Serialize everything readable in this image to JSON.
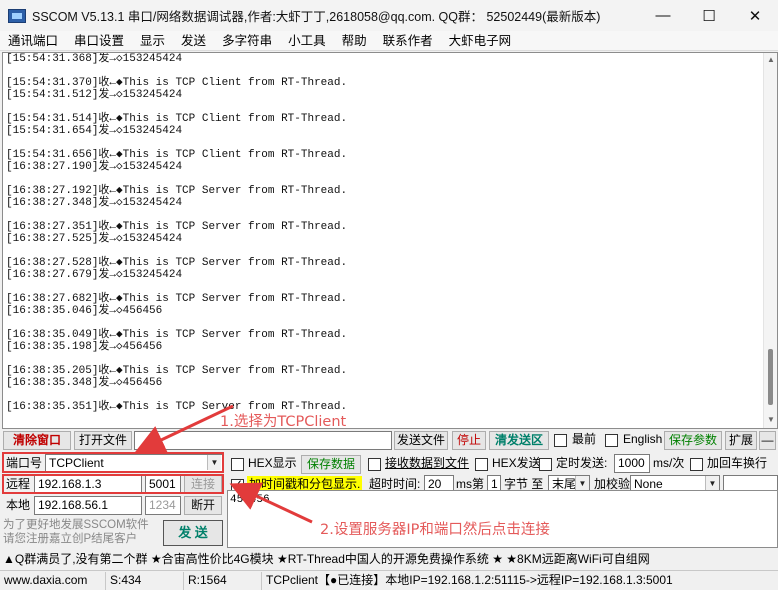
{
  "window": {
    "title": "SSCOM V5.13.1 串口/网络数据调试器,作者:大虾丁丁,2618058@qq.com. QQ群：  52502449(最新版本)",
    "minimize": "—",
    "maximize": "☐",
    "close": "✕"
  },
  "menu": [
    "通讯端口",
    "串口设置",
    "显示",
    "发送",
    "多字符串",
    "小工具",
    "帮助",
    "联系作者",
    "大虾电子网"
  ],
  "receive_lines": [
    "[15:54:31.368]发→◇153245424",
    "",
    "[15:54:31.370]收←◆This is TCP Client from RT-Thread.",
    "[15:54:31.512]发→◇153245424",
    "",
    "[15:54:31.514]收←◆This is TCP Client from RT-Thread.",
    "[15:54:31.654]发→◇153245424",
    "",
    "[15:54:31.656]收←◆This is TCP Client from RT-Thread.",
    "[16:38:27.190]发→◇153245424",
    "",
    "[16:38:27.192]收←◆This is TCP Server from RT-Thread.",
    "[16:38:27.348]发→◇153245424",
    "",
    "[16:38:27.351]收←◆This is TCP Server from RT-Thread.",
    "[16:38:27.525]发→◇153245424",
    "",
    "[16:38:27.528]收←◆This is TCP Server from RT-Thread.",
    "[16:38:27.679]发→◇153245424",
    "",
    "[16:38:27.682]收←◆This is TCP Server from RT-Thread.",
    "[16:38:35.046]发→◇456456",
    "",
    "[16:38:35.049]收←◆This is TCP Server from RT-Thread.",
    "[16:38:35.198]发→◇456456",
    "",
    "[16:38:35.205]收←◆This is TCP Server from RT-Thread.",
    "[16:38:35.348]发→◇456456",
    "",
    "[16:38:35.351]收←◆This is TCP Server from RT-Thread."
  ],
  "toolbar": {
    "clear_window": "清除窗口",
    "open_file": "打开文件",
    "send_file": "发送文件",
    "stop": "停止",
    "clear_send": "清发送区",
    "topmost": "最前",
    "english": "English",
    "save_params": "保存参数",
    "expand": "扩展",
    "collapse": "—"
  },
  "port": {
    "label": "端口号",
    "value": "TCPClient",
    "hex_display": "HEX显示",
    "save_data": "保存数据",
    "recv_to_file": "接收数据到文件",
    "hex_send": "HEX发送",
    "timed_send": "定时发送:",
    "interval": "1000",
    "interval_unit": "ms/次",
    "add_crlf": "加回车换行"
  },
  "remote": {
    "label": "远程",
    "ip": "192.168.1.3",
    "port": "5001",
    "connect": "连接",
    "timestamp_label": "加时间戳和分包显示.",
    "timeout_label": "超时时间:",
    "timeout": "20",
    "timeout_unit": "ms",
    "nth_label": "第",
    "nth": "1",
    "byte_label": "字节 至",
    "tail": "末尾",
    "checksum_label": "加校验",
    "checksum": "None"
  },
  "local": {
    "label": "本地",
    "ip": "192.168.56.1",
    "port": "1234",
    "disconnect": "断开"
  },
  "promo": {
    "line1": "为了更好地发展SSCOM软件",
    "line2": "请您注册嘉立创P结尾客户",
    "send_button": "发 送",
    "send_text": "456456"
  },
  "marquee": "▲Q群满员了,没有第二个群  ★合宙高性价比4G模块 ★RT-Thread中国人的开源免费操作系统 ★ ★8KM远距离WiFi可自组网",
  "status": {
    "site": "www.daxia.com",
    "sent": "S:434",
    "received": "R:1564",
    "connection": "TCPclient【●已连接】本地IP=192.168.1.2:51115->远程IP=192.168.1.3:5001"
  },
  "annotations": {
    "step1": "1.选择为TCPClient",
    "step2": "2.设置服务器IP和端口然后点击连接"
  },
  "colors": {
    "annotation": "#e23b3b",
    "highlight": "#ffff00"
  }
}
